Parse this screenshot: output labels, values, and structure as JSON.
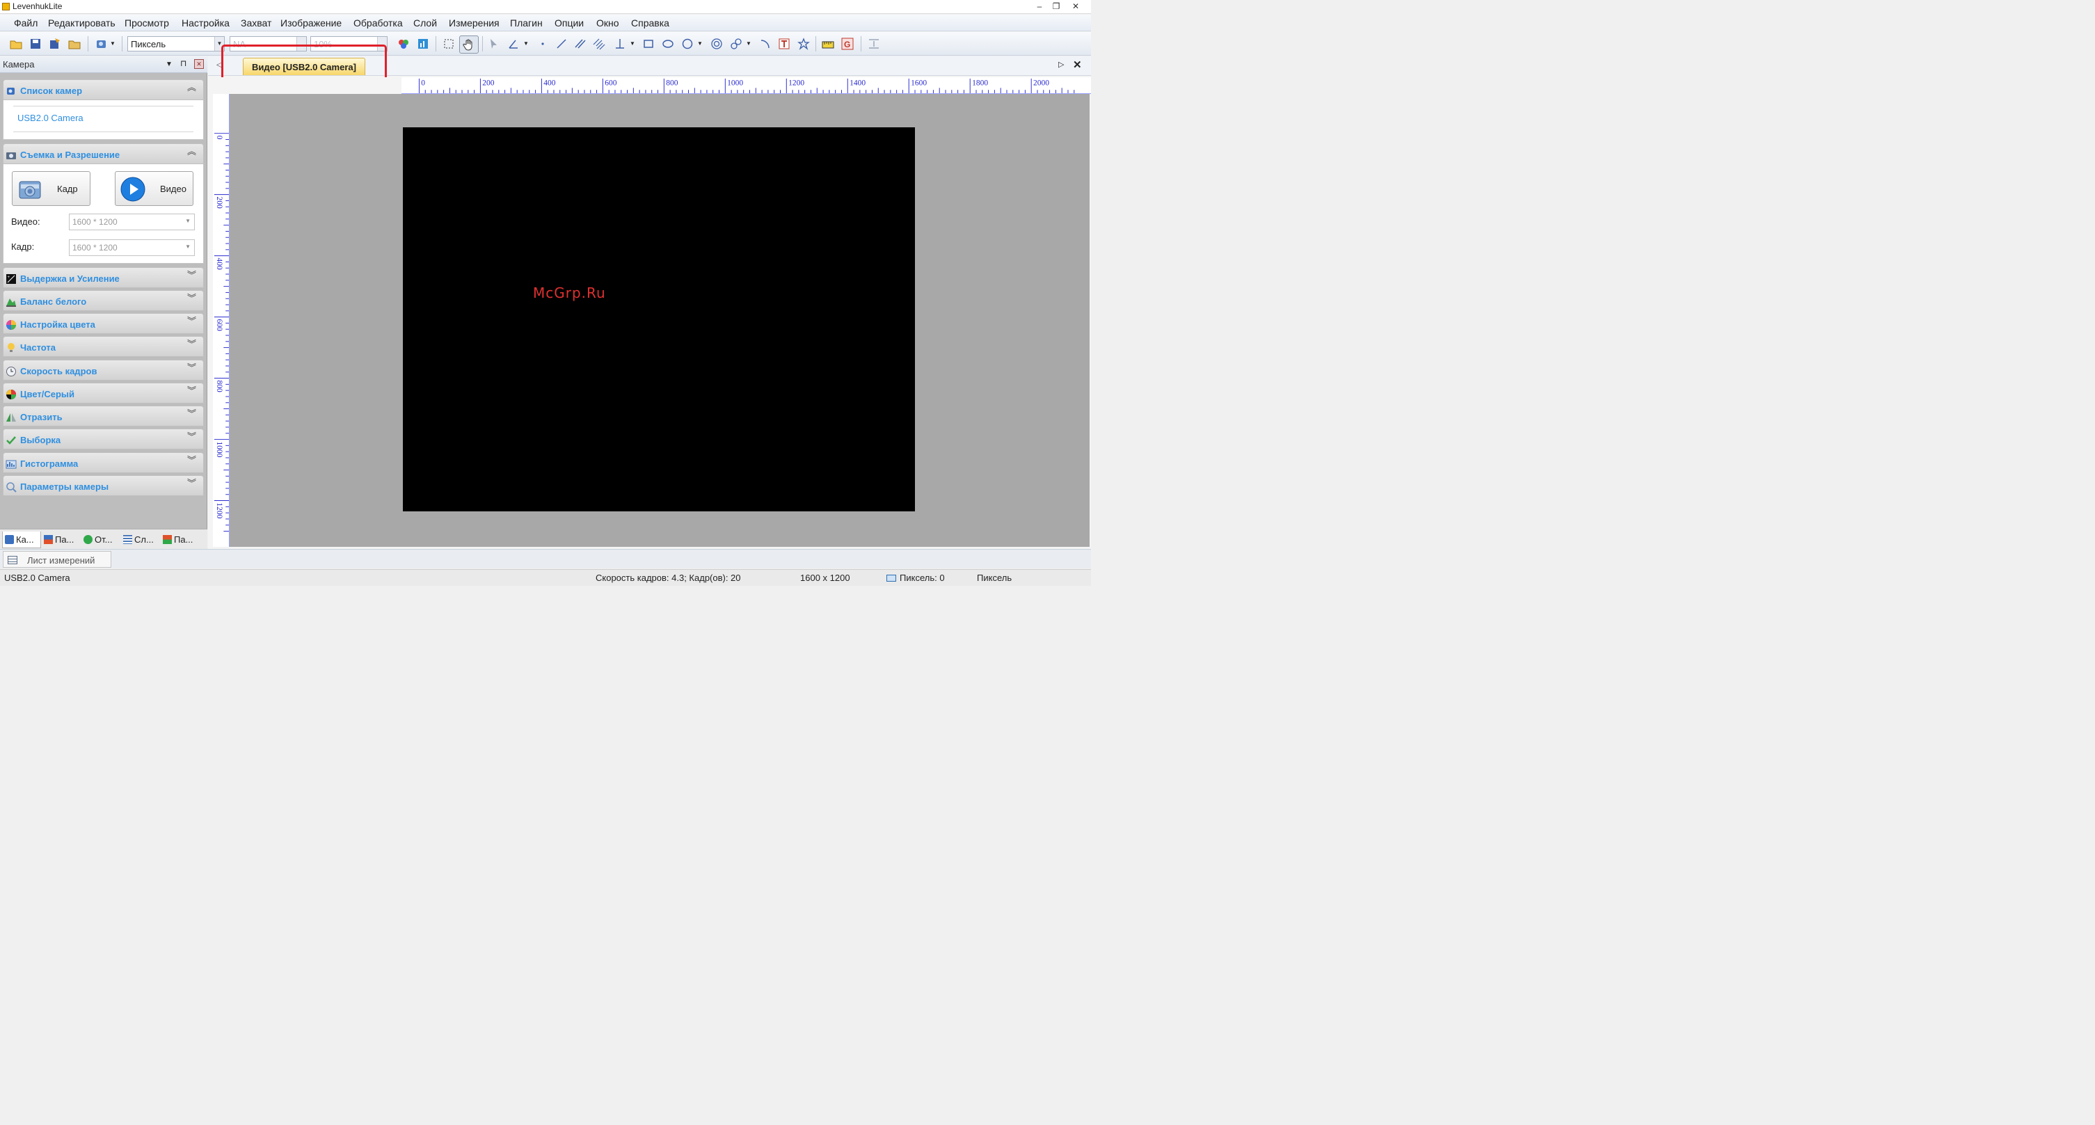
{
  "window": {
    "title": "LevenhukLite",
    "minimize": "–",
    "restore": "❐",
    "close": "✕"
  },
  "menu": [
    "Файл",
    "Редактировать",
    "Просмотр",
    "Настройка",
    "Захват",
    "Изображение",
    "Обработка",
    "Слой",
    "Измерения",
    "Плагин",
    "Опции",
    "Окно",
    "Справка"
  ],
  "toolbar": {
    "unit_combo": "Пиксель",
    "na_combo": "NA",
    "zoom_combo": "10%",
    "icons": [
      "open-folder-icon",
      "save-icon",
      "batch-save-icon",
      "browse-folder-icon",
      "camera-select-icon",
      "channels-icon",
      "image-info-icon",
      "roi-select-icon",
      "pan-hand-icon",
      "pointer-icon",
      "angle-icon",
      "point-icon",
      "line-icon",
      "parallel-icon",
      "double-parallel-icon",
      "perpendicular-icon",
      "rectangle-icon",
      "ellipse-icon",
      "circle-icon",
      "concentric-circles-icon",
      "two-circles-icon",
      "arc-icon",
      "text-icon",
      "polygon-icon",
      "calibration-icon",
      "grid-g-icon",
      "scale-bar-icon"
    ]
  },
  "left_panel": {
    "title": "Камера",
    "camera_list": {
      "title": "Список камер",
      "items": [
        "USB2.0 Camera"
      ]
    },
    "capture": {
      "title": "Съемка и Разрешение",
      "snap_label": "Кадр",
      "video_label": "Видео",
      "video_res_label": "Видео:",
      "video_res_value": "1600 * 1200",
      "frame_res_label": "Кадр:",
      "frame_res_value": "1600 * 1200"
    },
    "sections": [
      "Выдержка и Усиление",
      "Баланс белого",
      "Настройка цвета",
      "Частота",
      "Скорость кадров",
      "Цвет/Серый",
      "Отразить",
      "Выборка",
      "Гистограмма",
      "Параметры камеры"
    ],
    "bottom_tabs": [
      "Ка...",
      "Па...",
      "От...",
      "Сл...",
      "Па..."
    ]
  },
  "document": {
    "tab_title": "Видео [USB2.0 Camera]",
    "ruler_h_labels": [
      "0",
      "200",
      "400",
      "600",
      "800",
      "1000",
      "1200",
      "1400",
      "1600",
      "1800",
      "2000"
    ],
    "ruler_v_labels": [
      "0",
      "200",
      "400",
      "600",
      "800",
      "1000",
      "1200"
    ],
    "watermark": "McGrp.Ru"
  },
  "measure_sheet": {
    "label": "Лист измерений"
  },
  "status": {
    "camera": "USB2.0 Camera",
    "frame_rate": "Скорость кадров: 4.3; Кадр(ов): 20",
    "resolution": "1600 x 1200",
    "pixel": "Пиксель: 0",
    "unit": "Пиксель"
  },
  "colors": {
    "accent_blue": "#2f8fe0",
    "highlight_red": "#e0202b",
    "tab_yellow": "#f7d66a"
  }
}
